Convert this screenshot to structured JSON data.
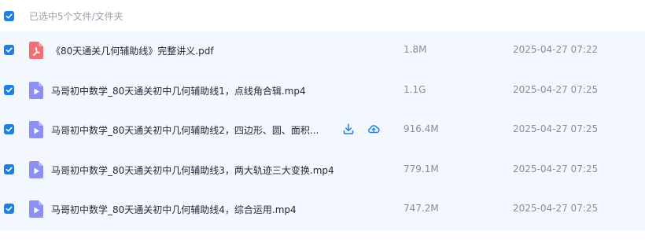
{
  "header": {
    "selection_text": "已选中5个文件/文件夹"
  },
  "files": [
    {
      "name": "《80天通关几何辅助线》完整讲义.pdf",
      "size": "1.8M",
      "date": "2025-04-27 07:22",
      "icon": "pdf-file-icon"
    },
    {
      "name": "马哥初中数学_80天通关初中几何辅助线1，点线角合辑.mp4",
      "size": "1.1G",
      "date": "2025-04-27 07:25",
      "icon": "video-file-icon"
    },
    {
      "name": "马哥初中数学_80天通关初中几何辅助线2，四边形、圆、面积...",
      "size": "916.4M",
      "date": "2025-04-27 07:25",
      "icon": "video-file-icon"
    },
    {
      "name": "马哥初中数学_80天通关初中几何辅助线3，两大轨迹三大变换.mp4",
      "size": "779.1M",
      "date": "2025-04-27 07:25",
      "icon": "video-file-icon"
    },
    {
      "name": "马哥初中数学_80天通关初中几何辅助线4，综合运用.mp4",
      "size": "747.2M",
      "date": "2025-04-27 07:25",
      "icon": "video-file-icon"
    }
  ],
  "colors": {
    "accent": "#1a7ff0",
    "row_bg": "#f3f8ff",
    "pdf": "#f56f72",
    "video": "#8d8ef6"
  }
}
